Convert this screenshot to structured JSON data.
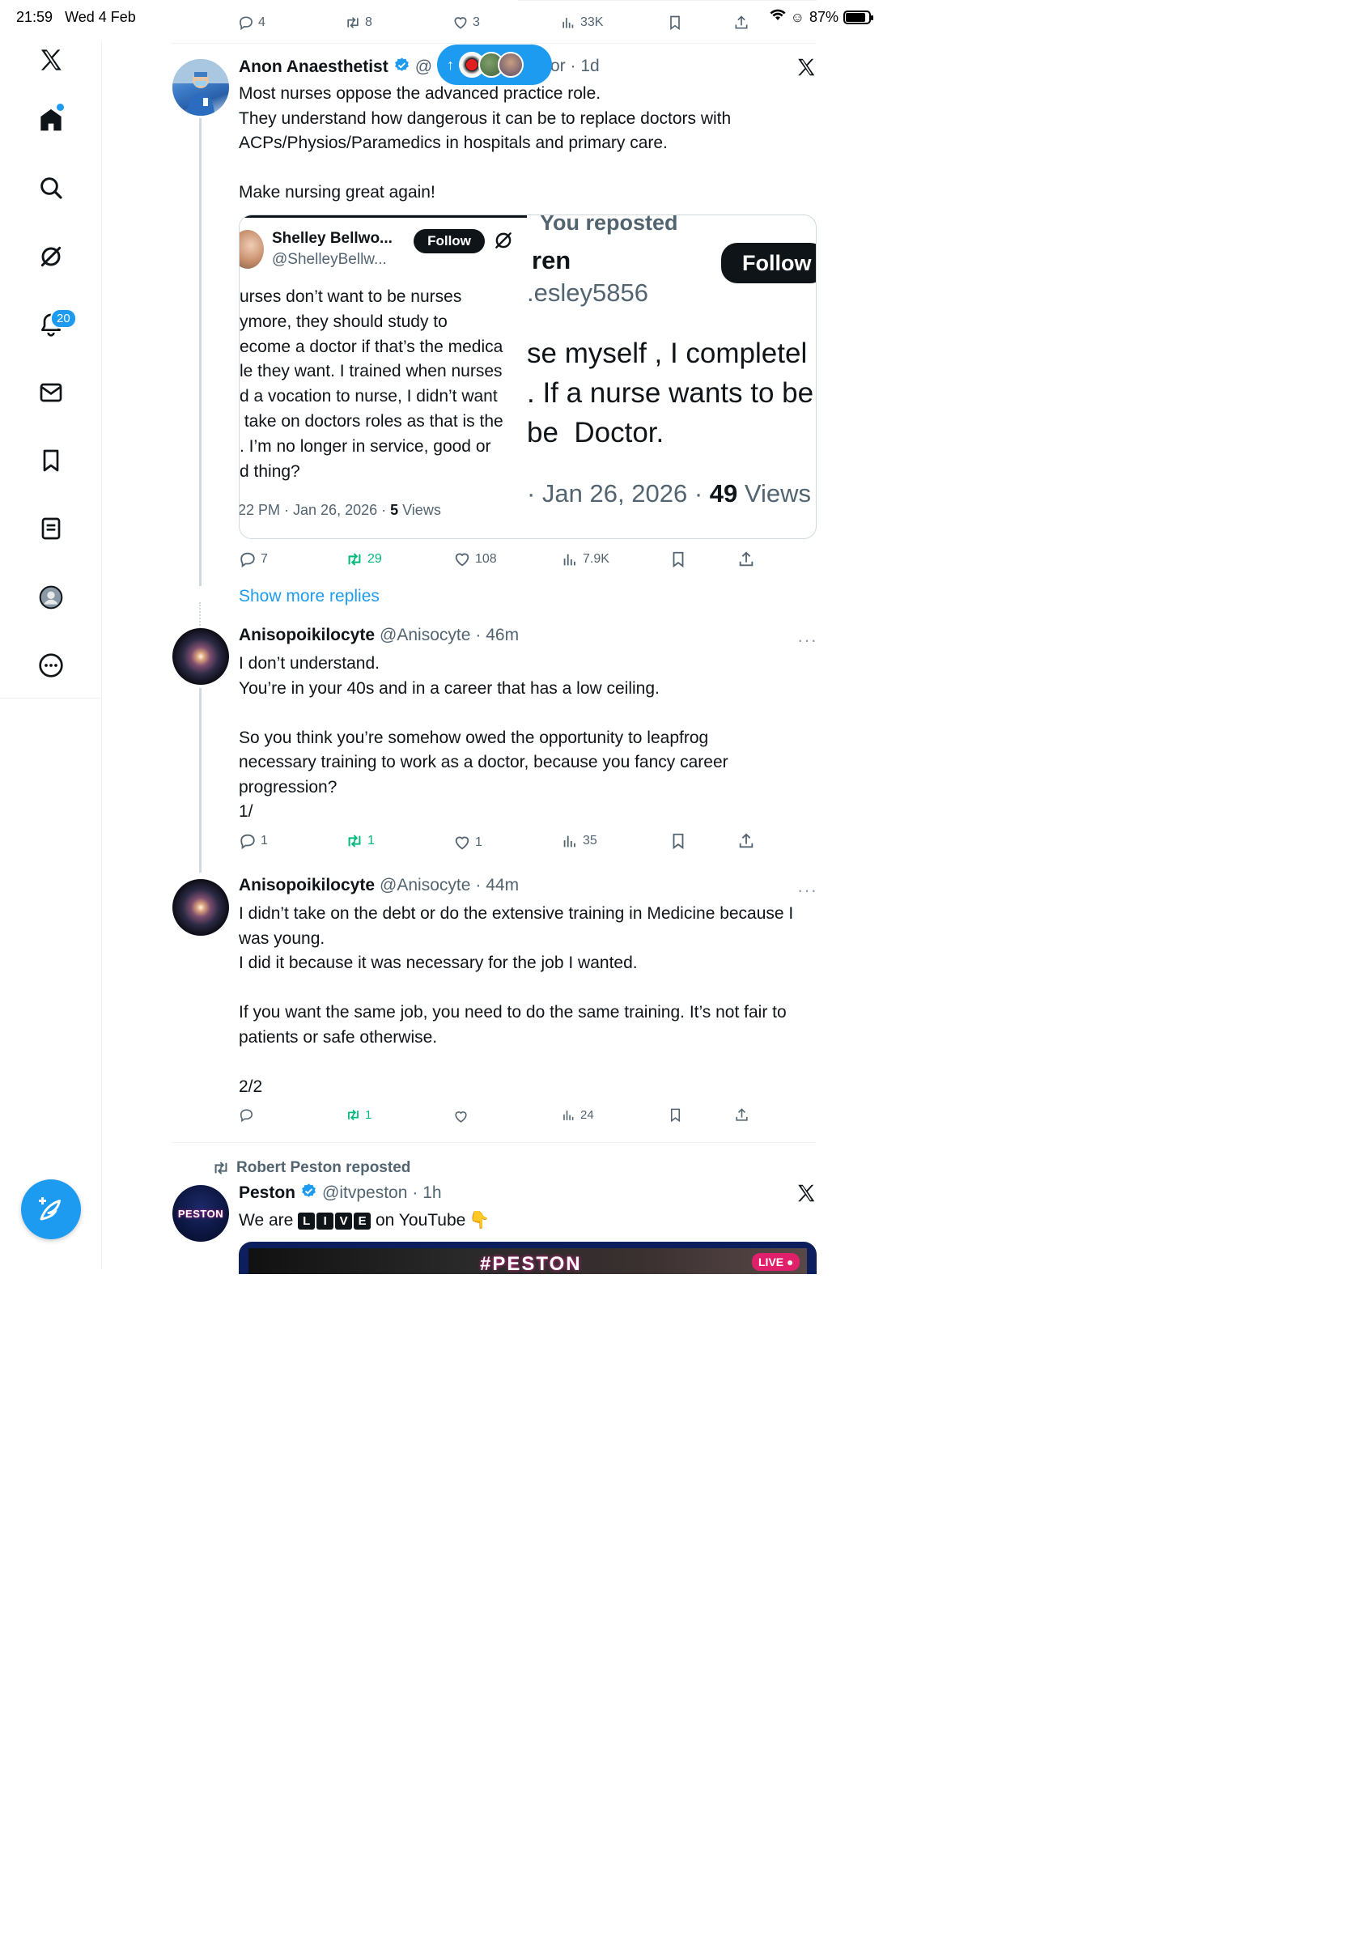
{
  "status_bar": {
    "time": "21:59",
    "date": "Wed 4 Feb",
    "battery": "87%"
  },
  "nav": {
    "notifications_badge": "20"
  },
  "top_actions": {
    "replies": "4",
    "reposts": "8",
    "likes": "3",
    "views": "33K"
  },
  "new_posts_pill": {
    "arrow": "↑"
  },
  "tweet1": {
    "name": "Anon Anaesthetist",
    "handle_frag": "@",
    "time_frag": "or · 1d",
    "text": "Most nurses oppose the advanced practice role.\nThey understand how dangerous it can be to replace doctors with ACPs/Physios/Paramedics in hospitals and primary care.\n\nMake nursing great again!",
    "quote_left": {
      "name": "Shelley Bellwo...",
      "handle": "@ShelleyBellw...",
      "follow": "Follow",
      "text": "urses don’t want to be nurses\nymore, they should study to\necome a doctor if that’s the medica\nle they want. I trained when nurses\nd a vocation to nurse, I didn’t want\n take on doctors roles as that is the\n. I’m no longer in service, good or\nd thing?",
      "time": "22 PM · Jan 26, 2026 · ",
      "views_num": "5",
      "views_label": " Views"
    },
    "quote_right": {
      "reposted": "You reposted",
      "name": "ren",
      "handle": ".esley5856",
      "follow": "Follow",
      "text": "se myself , I completel\n. If a nurse wants to be\nbe  Doctor.",
      "time": "· Jan 26, 2026 · ",
      "views_num": "49",
      "views_label": " Views"
    },
    "actions": {
      "replies": "7",
      "reposts": "29",
      "likes": "108",
      "views": "7.9K"
    }
  },
  "show_more": "Show more replies",
  "tweet2": {
    "name": "Anisopoikilocyte",
    "handle": "@Anisocyte",
    "time": "· 46m",
    "text": "I don’t understand.\nYou’re in your 40s and in a career that has a low ceiling.\n\nSo you think you’re somehow owed the opportunity to leapfrog necessary training to work as a doctor, because you fancy career progression?\n1/",
    "actions": {
      "replies": "1",
      "reposts": "1",
      "likes": "1",
      "views": "35"
    }
  },
  "tweet3": {
    "name": "Anisopoikilocyte",
    "handle": "@Anisocyte",
    "time": "· 44m",
    "text": "I didn’t take on the debt or do the extensive training in Medicine because I was young.\nI did it because it was necessary for the job I wanted.\n\nIf you want the same job, you need to do the same training. It’s not fair to patients or safe otherwise.\n\n2/2",
    "actions": {
      "replies": "",
      "reposts": "1",
      "likes": "",
      "views": "24"
    }
  },
  "tweet4": {
    "reposted_by": "Robert Peston reposted",
    "name": "Peston",
    "handle": "@itvpeston",
    "time": "· 1h",
    "text_before": "We are ",
    "live_letters": [
      "L",
      "I",
      "V",
      "E"
    ],
    "text_after": " on YouTube",
    "emoji": "👇",
    "avatar_text": "PESTON",
    "media_title": "#PESTON",
    "media_badge": "LIVE"
  },
  "colors": {
    "accent": "#1d9bf0",
    "repost_green": "#00ba7c",
    "text": "#0f1419",
    "muted": "#536471"
  }
}
